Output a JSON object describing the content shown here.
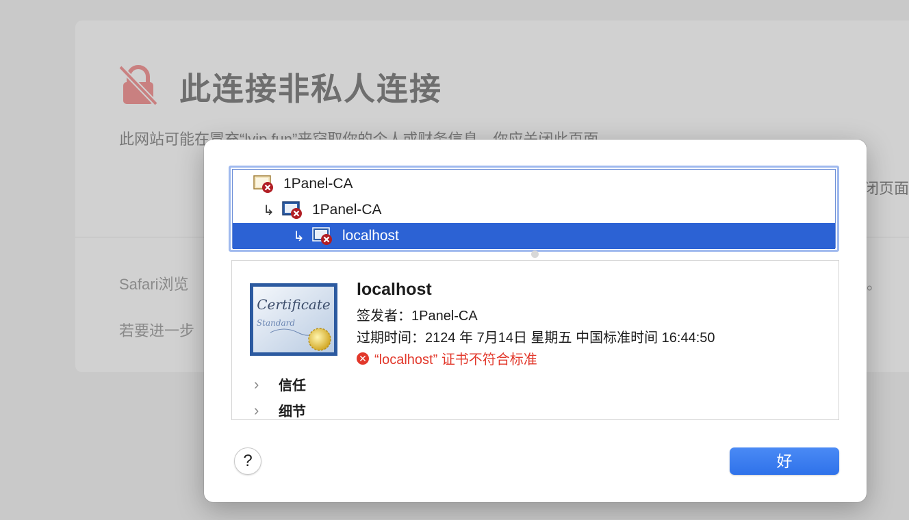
{
  "background_page": {
    "title": "此连接非私人连接",
    "subtitle": "此网站可能在冒充“lyip.fun”来窃取你的个人或财务信息。你应关闭此页面。",
    "close_button_fragment": "闭页面",
    "paragraph1_start": "Safari浏览",
    "paragraph1_end": "。",
    "paragraph2_start": "若要进一步"
  },
  "chain": {
    "items": [
      {
        "label": "1Panel-CA",
        "level": 0,
        "selected": false
      },
      {
        "label": "1Panel-CA",
        "level": 1,
        "selected": false
      },
      {
        "label": "localhost",
        "level": 2,
        "selected": true
      }
    ],
    "child_arrow": "↳"
  },
  "certificate": {
    "name": "localhost",
    "issuer_line": "签发者：1Panel-CA",
    "expiry_line": "过期时间：2124 年 7月14日 星期五 中国标准时间 16:44:50",
    "error_line": "“localhost” 证书不符合标准",
    "image_text_title": "Certificate",
    "image_text_sub": "Standard"
  },
  "sections": {
    "trust": "信任",
    "details": "细节"
  },
  "buttons": {
    "help": "?",
    "ok": "好"
  },
  "colors": {
    "selection": "#2c62d4",
    "error": "#e2382b",
    "ok_button": "#3578ed"
  }
}
